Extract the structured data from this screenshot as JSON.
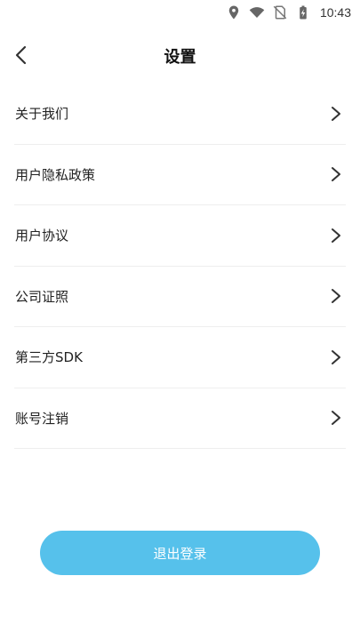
{
  "status_bar": {
    "time": "10:43",
    "icons": [
      "location-icon",
      "wifi-icon",
      "no-sim-icon",
      "battery-charging-icon"
    ]
  },
  "header": {
    "title": "设置",
    "back_icon": "chevron-left-icon"
  },
  "menu": {
    "items": [
      {
        "label": "关于我们"
      },
      {
        "label": "用户隐私政策"
      },
      {
        "label": "用户协议"
      },
      {
        "label": "公司证照"
      },
      {
        "label": "第三方SDK"
      },
      {
        "label": "账号注销"
      }
    ],
    "chevron_icon": "chevron-right-icon"
  },
  "actions": {
    "logout_label": "退出登录"
  },
  "colors": {
    "accent": "#56c1eb",
    "divider": "#eeeeee",
    "text": "#222222"
  }
}
